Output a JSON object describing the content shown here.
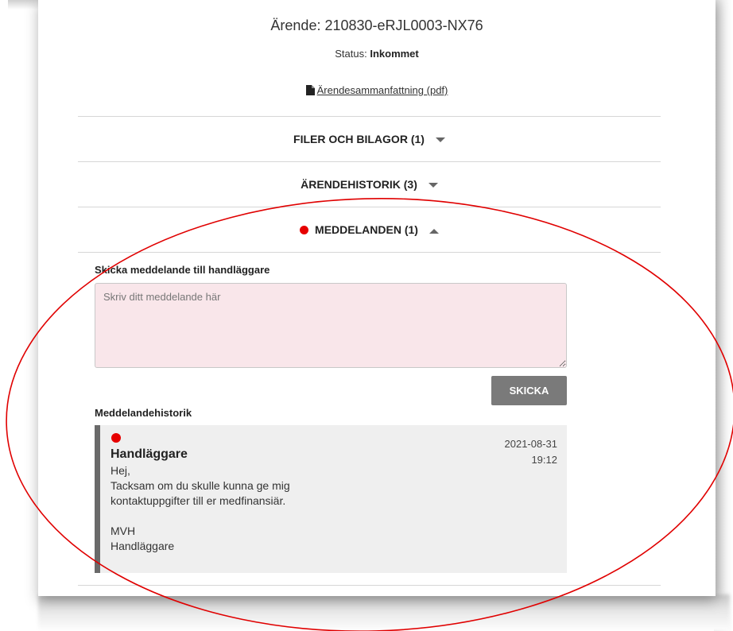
{
  "case": {
    "title": "Ärende: 210830-eRJL0003-NX76",
    "status_label": "Status:",
    "status_value": "Inkommet",
    "summary_link": "Ärendesammanfattning (pdf)"
  },
  "sections": [
    {
      "label": "FILER OCH BILAGOR (1)",
      "state": "collapsed"
    },
    {
      "label": "ÄRENDEHISTORIK (3)",
      "state": "collapsed"
    },
    {
      "label": "MEDDELANDEN (1)",
      "state": "expanded",
      "unread": true
    }
  ],
  "compose": {
    "label": "Skicka meddelande till handläggare",
    "placeholder": "Skriv ditt meddelande här",
    "value": "",
    "send_label": "SKICKA"
  },
  "history": {
    "label": "Meddelandehistorik",
    "messages": [
      {
        "unread": true,
        "sender": "Handläggare",
        "date": "2021-08-31",
        "time": "19:12",
        "body": "Hej,\nTacksam om du skulle kunna ge mig\nkontaktuppgifter till er medfinansiär.\n\nMVH\nHandläggare"
      }
    ]
  },
  "colors": {
    "unread_dot": "#e60000",
    "annotation_ellipse": "#e00000",
    "input_background": "#f9e6ea",
    "button_background": "#7a7a7a",
    "message_border": "#6a6a6a"
  }
}
